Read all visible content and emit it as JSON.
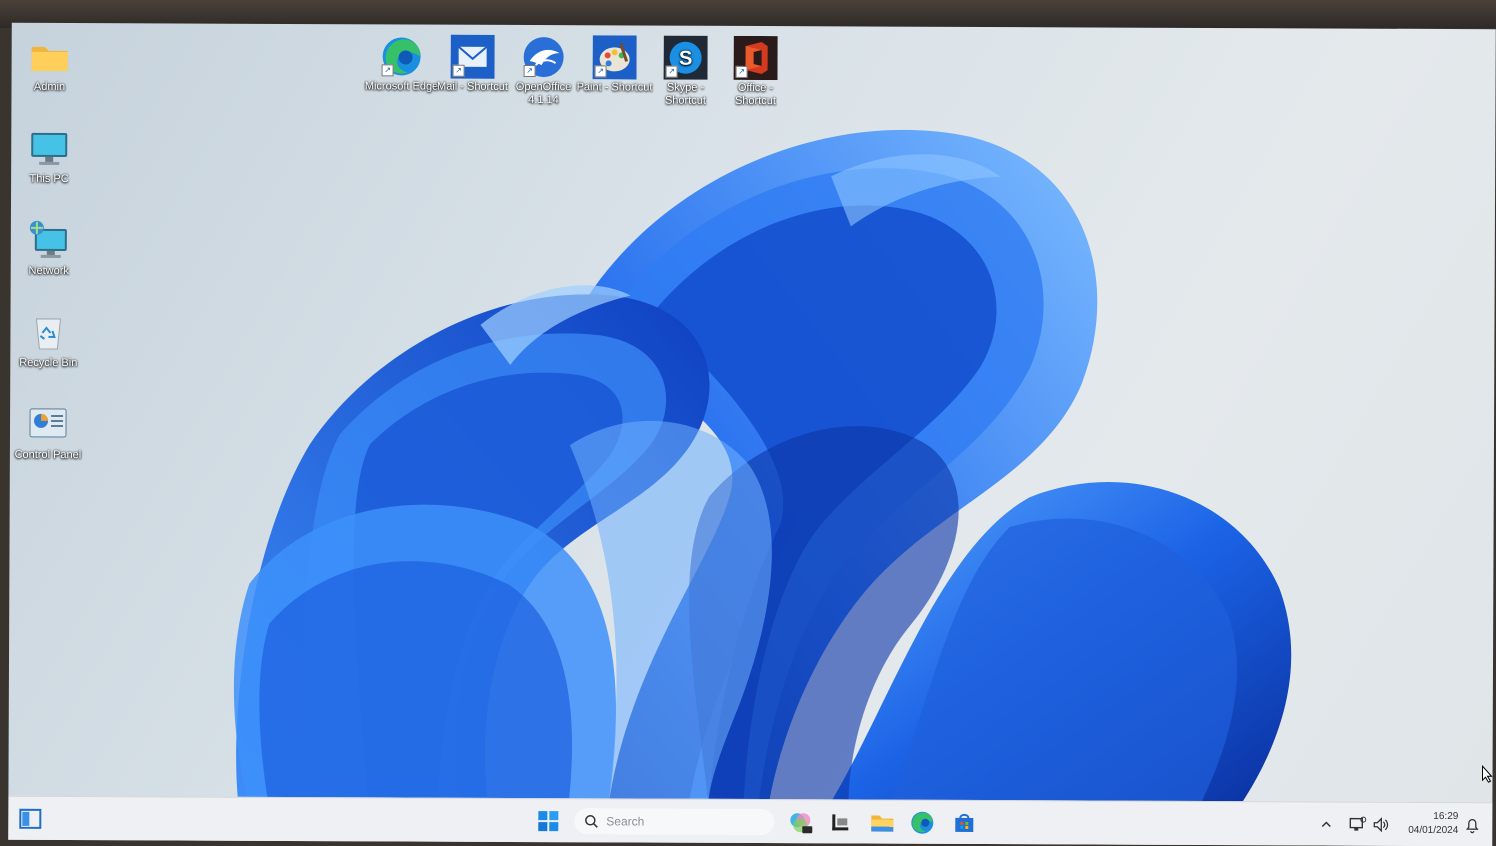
{
  "desktop": {
    "left_icons": [
      {
        "name": "admin",
        "label": "Admin",
        "icon": "folder-icon"
      },
      {
        "name": "this-pc",
        "label": "This PC",
        "icon": "monitor-icon"
      },
      {
        "name": "network",
        "label": "Network",
        "icon": "network-icon"
      },
      {
        "name": "recycle-bin",
        "label": "Recycle Bin",
        "icon": "recycle-bin-icon"
      },
      {
        "name": "control-panel",
        "label": "Control Panel",
        "icon": "control-panel-icon"
      }
    ],
    "top_icons": [
      {
        "name": "microsoft-edge",
        "label": "Microsoft Edge",
        "icon": "edge-icon"
      },
      {
        "name": "mail-shortcut",
        "label": "Mail - Shortcut",
        "icon": "mail-icon"
      },
      {
        "name": "openoffice",
        "label": "OpenOffice 4.1.14",
        "icon": "openoffice-icon"
      },
      {
        "name": "paint-shortcut",
        "label": "Paint - Shortcut",
        "icon": "paint-icon"
      },
      {
        "name": "skype-shortcut",
        "label": "Skype - Shortcut",
        "icon": "skype-icon"
      },
      {
        "name": "office-shortcut",
        "label": "Office - Shortcut",
        "icon": "office-icon"
      }
    ]
  },
  "taskbar": {
    "search_placeholder": "Search",
    "time": "16:29",
    "date": "04/01/2024",
    "items": [
      "widgets-icon",
      "start-icon",
      "copilot-icon",
      "task-view-icon",
      "file-explorer-icon",
      "edge-icon",
      "store-icon"
    ]
  },
  "colors": {
    "accent": "#1a6fe0",
    "bloom_dark": "#0b3fb8",
    "taskbar_bg": "#eef0f3"
  }
}
